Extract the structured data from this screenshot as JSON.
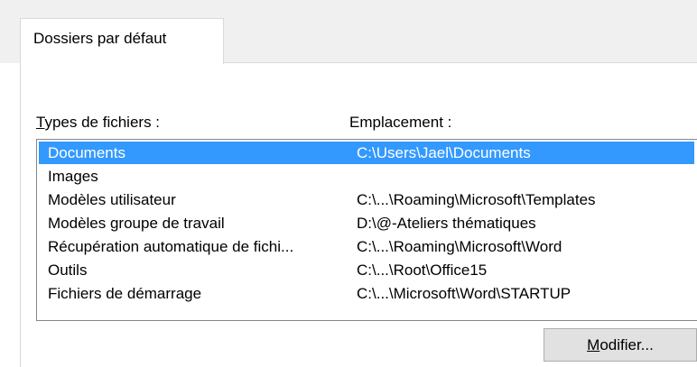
{
  "tabs": [
    {
      "label": "Dossiers par défaut",
      "active": true
    }
  ],
  "labels": {
    "file_types_accel": "T",
    "file_types_rest": "ypes de fichiers :",
    "location": "Emplacement :"
  },
  "file_locations": [
    {
      "type": "Documents",
      "location": "C:\\Users\\Jael\\Documents",
      "selected": true
    },
    {
      "type": "Images",
      "location": ""
    },
    {
      "type": "Modèles utilisateur",
      "location": "C:\\...\\Roaming\\Microsoft\\Templates"
    },
    {
      "type": "Modèles groupe de travail",
      "location": "D:\\@-Ateliers thématiques"
    },
    {
      "type": "Récupération automatique de fichi...",
      "location": "C:\\...\\Roaming\\Microsoft\\Word"
    },
    {
      "type": "Outils",
      "location": "C:\\...\\Root\\Office15"
    },
    {
      "type": "Fichiers de démarrage",
      "location": "C:\\...\\Microsoft\\Word\\STARTUP"
    }
  ],
  "buttons": {
    "modify_accel": "M",
    "modify_rest": "odifier..."
  },
  "colors": {
    "selection": "#3399ff",
    "tab_strip": "#f0f0f0",
    "border": "#828790"
  }
}
